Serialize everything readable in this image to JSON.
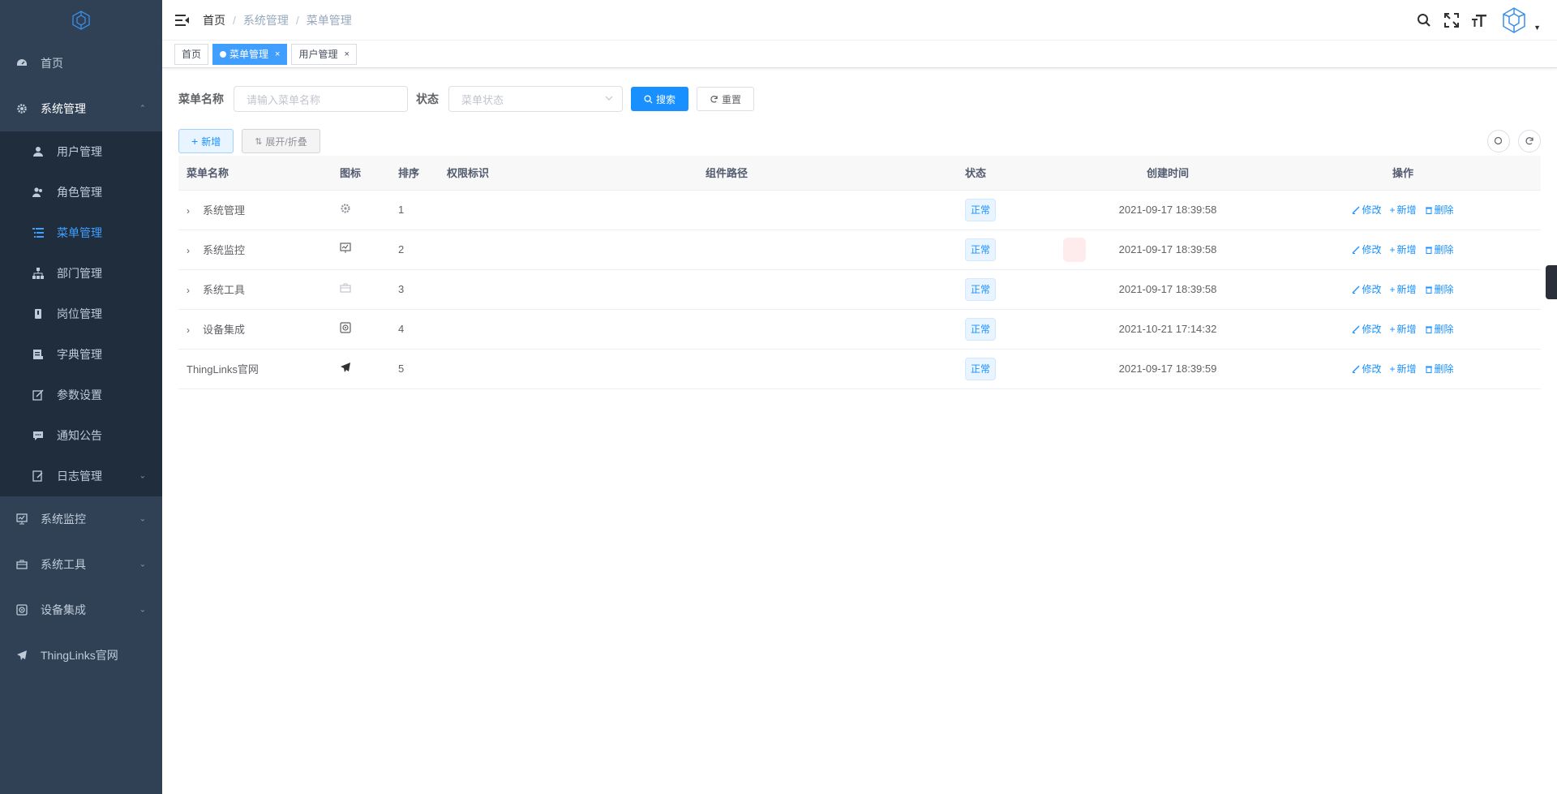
{
  "sidebar": {
    "items": [
      {
        "label": "首页",
        "icon": "dashboard-icon"
      },
      {
        "label": "系统管理",
        "icon": "gear-icon"
      },
      {
        "label": "系统监控",
        "icon": "monitor-icon"
      },
      {
        "label": "系统工具",
        "icon": "toolbox-icon"
      },
      {
        "label": "设备集成",
        "icon": "device-icon"
      },
      {
        "label": "ThingLinks官网",
        "icon": "send-icon"
      }
    ],
    "submenu": [
      {
        "label": "用户管理",
        "icon": "user-icon"
      },
      {
        "label": "角色管理",
        "icon": "peoples-icon"
      },
      {
        "label": "菜单管理",
        "icon": "tree-table-icon"
      },
      {
        "label": "部门管理",
        "icon": "tree-icon"
      },
      {
        "label": "岗位管理",
        "icon": "post-icon"
      },
      {
        "label": "字典管理",
        "icon": "dict-icon"
      },
      {
        "label": "参数设置",
        "icon": "edit-icon"
      },
      {
        "label": "通知公告",
        "icon": "message-icon"
      },
      {
        "label": "日志管理",
        "icon": "log-icon"
      }
    ]
  },
  "breadcrumb": [
    "首页",
    "系统管理",
    "菜单管理"
  ],
  "tags": [
    {
      "label": "首页"
    },
    {
      "label": "菜单管理"
    },
    {
      "label": "用户管理"
    }
  ],
  "search": {
    "name_label": "菜单名称",
    "name_placeholder": "请输入菜单名称",
    "status_label": "状态",
    "status_placeholder": "菜单状态",
    "search_btn": "搜索",
    "reset_btn": "重置"
  },
  "toolbar": {
    "add_btn": "新增",
    "expand_btn": "展开/折叠"
  },
  "table": {
    "headers": [
      "菜单名称",
      "图标",
      "排序",
      "权限标识",
      "组件路径",
      "状态",
      "创建时间",
      "操作"
    ],
    "rows": [
      {
        "name": "系统管理",
        "icon": "gear-icon",
        "order": "1",
        "perm": "",
        "component": "",
        "status": "正常",
        "created": "2021-09-17 18:39:58",
        "expandable": true
      },
      {
        "name": "系统监控",
        "icon": "monitor-icon",
        "order": "2",
        "perm": "",
        "component": "",
        "status": "正常",
        "created": "2021-09-17 18:39:58",
        "expandable": true
      },
      {
        "name": "系统工具",
        "icon": "toolbox-icon",
        "order": "3",
        "perm": "",
        "component": "",
        "status": "正常",
        "created": "2021-09-17 18:39:58",
        "expandable": true
      },
      {
        "name": "设备集成",
        "icon": "device-icon",
        "order": "4",
        "perm": "",
        "component": "",
        "status": "正常",
        "created": "2021-10-21 17:14:32",
        "expandable": true
      },
      {
        "name": "ThingLinks官网",
        "icon": "send-icon",
        "order": "5",
        "perm": "",
        "component": "",
        "status": "正常",
        "created": "2021-09-17 18:39:59",
        "expandable": false
      }
    ],
    "ops": {
      "edit": "修改",
      "add": "新增",
      "delete": "删除"
    }
  },
  "colors": {
    "sidebar_bg": "#304156",
    "submenu_bg": "#1f2d3d",
    "primary": "#1890ff",
    "active_menu": "#409eff"
  }
}
